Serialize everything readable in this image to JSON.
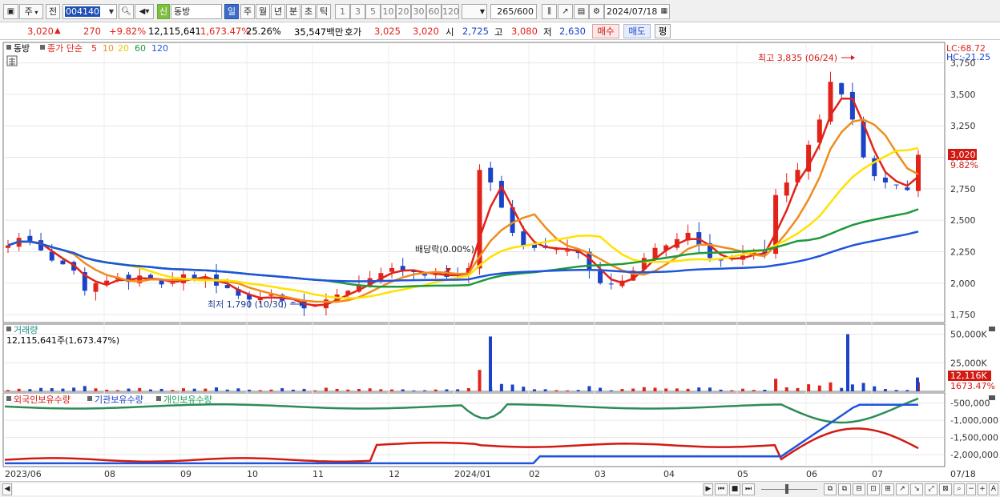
{
  "toolbar": {
    "market": "주",
    "prev": "전",
    "code": "004140",
    "badge": "신",
    "name": "동방",
    "periods": [
      "일",
      "주",
      "월",
      "년",
      "분",
      "초",
      "틱"
    ],
    "active_period": "일",
    "numbers": [
      "1",
      "3",
      "5",
      "10",
      "20",
      "30",
      "60",
      "120"
    ],
    "count": "265",
    "total": "/600",
    "date": "2024/07/18"
  },
  "quote": {
    "price": "3,020",
    "arrow": "▲",
    "change": "270",
    "change_pct": "+9.82%",
    "volume": "12,115,641",
    "volume_pct": "1,673.47%",
    "turnover_pct": "25.26%",
    "amount": "35,547백만",
    "hoga_label": "호가",
    "ask": "3,025",
    "bid": "3,020",
    "open_label": "시",
    "open": "2,725",
    "high_label": "고",
    "high": "3,080",
    "low_label": "저",
    "low": "2,630",
    "buy_label": "매수",
    "sell_label": "매도",
    "avg_label": "평"
  },
  "legend": {
    "stock": "동방",
    "indicator": "종가 단순",
    "periods": [
      "5",
      "10",
      "20",
      "60",
      "120"
    ],
    "colors": [
      "#e2231a",
      "#f08c1e",
      "#ffe200",
      "#1e9a3c",
      "#1e55dc"
    ]
  },
  "annotations": {
    "lc": "LC:68.72",
    "hc": "HC:-21.25",
    "high_mark": "최고 3,835 (06/24)",
    "low_mark": "최저 1,790 (10/30)",
    "dividend": "배당락(0.00%)",
    "last_price": "3,020",
    "last_pct": "9.82%"
  },
  "volume_panel": {
    "title": "거래량",
    "info": "12,115,641주(1,673.47%)",
    "last": "12,116K",
    "last_pct": "1673.47%"
  },
  "holdings_panel": {
    "foreign": "외국인보유수량",
    "inst": "기관보유수량",
    "indiv": "개인보유수량"
  },
  "chart_data": {
    "type": "candlestick",
    "price_axis": [
      "3,750",
      "3,500",
      "3,250",
      "3,000",
      "2,750",
      "2,500",
      "2,250",
      "2,000",
      "1,750"
    ],
    "volume_axis": [
      "50,000K",
      "25,000K"
    ],
    "holdings_axis": [
      "-500,000",
      "-1,000,000",
      "-1,500,000",
      "-2,000,000"
    ],
    "x_labels": [
      "2023/06",
      "08",
      "09",
      "10",
      "11",
      "12",
      "2024/01",
      "02",
      "03",
      "04",
      "05",
      "06",
      "07",
      "07/18"
    ],
    "price_range": [
      1700,
      3900
    ],
    "close_series": [
      2300,
      2360,
      2330,
      2260,
      2180,
      2150,
      2100,
      1940,
      2000,
      2020,
      2050,
      2010,
      2060,
      2040,
      1990,
      2000,
      2070,
      2030,
      2050,
      1980,
      1960,
      1900,
      1870,
      1880,
      1910,
      1860,
      1850,
      1800,
      1820,
      1870,
      1910,
      1940,
      1990,
      2040,
      2080,
      2120,
      2100,
      2090,
      2060,
      2080,
      2050,
      2060,
      2120,
      2900,
      2800,
      2600,
      2400,
      2300,
      2280,
      2280,
      2270,
      2260,
      2240,
      2100,
      2000,
      1990,
      2020,
      2100,
      2200,
      2280,
      2300,
      2350,
      2400,
      2300,
      2200,
      2180,
      2200,
      2220,
      2250,
      2240,
      2700,
      2800,
      2900,
      3100,
      3300,
      3600,
      3500,
      3300,
      3000,
      2850,
      2800,
      2780,
      2740,
      3020
    ],
    "ma_series": [
      {
        "name": "5",
        "color": "#e2231a"
      },
      {
        "name": "10",
        "color": "#f08c1e"
      },
      {
        "name": "20",
        "color": "#ffe200"
      },
      {
        "name": "60",
        "color": "#1e9a3c"
      },
      {
        "name": "120",
        "color": "#1e55dc"
      }
    ],
    "volume_spikes": [
      {
        "x_label": "2024/01",
        "value_k": 48000
      },
      {
        "x_label": "06",
        "value_k": 50000
      },
      {
        "x_label": "07/18",
        "value_k": 12116
      }
    ]
  }
}
